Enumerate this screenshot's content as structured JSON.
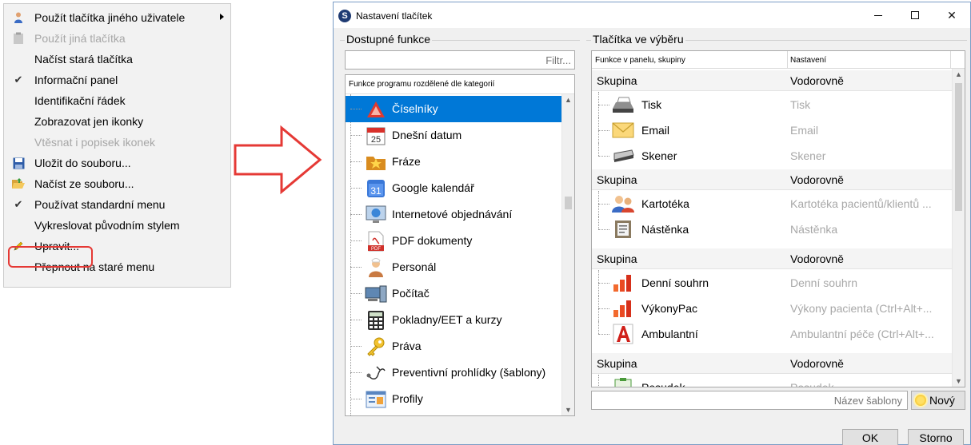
{
  "context_menu": {
    "items": [
      {
        "label": "Použít tlačítka jiného uživatele",
        "icon": "user-icon",
        "disabled": false,
        "checked": false,
        "submenu": true
      },
      {
        "label": "Použít jiná tlačítka",
        "icon": "clipboard-icon",
        "disabled": true,
        "checked": false,
        "submenu": false
      },
      {
        "label": "Načíst stará tlačítka",
        "icon": "",
        "disabled": false,
        "checked": false,
        "submenu": false
      },
      {
        "label": "Informační panel",
        "icon": "check-icon",
        "disabled": false,
        "checked": true,
        "submenu": false
      },
      {
        "label": "Identifikační řádek",
        "icon": "",
        "disabled": false,
        "checked": false,
        "submenu": false
      },
      {
        "label": "Zobrazovat jen ikonky",
        "icon": "",
        "disabled": false,
        "checked": false,
        "submenu": false
      },
      {
        "label": "Vtěsnat i popisek ikonek",
        "icon": "",
        "disabled": true,
        "checked": false,
        "submenu": false
      },
      {
        "label": "Uložit do souboru...",
        "icon": "floppy-icon",
        "disabled": false,
        "checked": false,
        "submenu": false
      },
      {
        "label": "Načíst ze souboru...",
        "icon": "folder-open-icon",
        "disabled": false,
        "checked": false,
        "submenu": false
      },
      {
        "label": "Používat standardní menu",
        "icon": "check-icon",
        "disabled": false,
        "checked": true,
        "submenu": false
      },
      {
        "label": "Vykreslovat původním stylem",
        "icon": "",
        "disabled": false,
        "checked": false,
        "submenu": false
      },
      {
        "label": "Upravit...",
        "icon": "pencil-icon",
        "disabled": false,
        "checked": false,
        "submenu": false
      },
      {
        "label": "Přepnout na staré menu",
        "icon": "",
        "disabled": false,
        "checked": false,
        "submenu": false
      }
    ]
  },
  "dialog": {
    "title": "Nastavení tlačítek",
    "app_icon_letter": "S",
    "left_group_title": "Dostupné funkce",
    "right_group_title": "Tlačítka ve výběru",
    "filter_placeholder": "Filtr...",
    "tree_header": "Funkce programu rozdělené dle kategorií",
    "tree_items": [
      {
        "label": "Číselníky",
        "icon": "ciselniky-icon",
        "selected": true
      },
      {
        "label": "Dnešní datum",
        "icon": "calendar-25-icon",
        "selected": false
      },
      {
        "label": "Fráze",
        "icon": "star-folder-icon",
        "selected": false
      },
      {
        "label": "Google kalendář",
        "icon": "google-calendar-icon",
        "selected": false
      },
      {
        "label": "Internetové objednávání",
        "icon": "monitor-globe-icon",
        "selected": false
      },
      {
        "label": "PDF dokumenty",
        "icon": "pdf-icon",
        "selected": false
      },
      {
        "label": "Personál",
        "icon": "nurse-icon",
        "selected": false
      },
      {
        "label": "Počítač",
        "icon": "computer-icon",
        "selected": false
      },
      {
        "label": "Pokladny/EET a kurzy",
        "icon": "calculator-icon",
        "selected": false
      },
      {
        "label": "Práva",
        "icon": "key-icon",
        "selected": false
      },
      {
        "label": "Preventivní prohlídky (šablony)",
        "icon": "stethoscope-icon",
        "selected": false
      },
      {
        "label": "Profily",
        "icon": "profile-window-icon",
        "selected": false
      }
    ],
    "table_header": {
      "col1": "Funkce v panelu, skupiny",
      "col2": "Nastavení"
    },
    "groups": [
      {
        "label": "Skupina",
        "setting": "Vodorovně",
        "rows": [
          {
            "label": "Tisk",
            "value": "Tisk",
            "icon": "printer-icon"
          },
          {
            "label": "Email",
            "value": "Email",
            "icon": "envelope-icon"
          },
          {
            "label": "Skener",
            "value": "Skener",
            "icon": "scanner-icon"
          }
        ]
      },
      {
        "label": "Skupina",
        "setting": "Vodorovně",
        "rows": [
          {
            "label": "Kartotéka",
            "value": "Kartotéka pacientů/klientů ...",
            "icon": "people-icon"
          },
          {
            "label": "Nástěnka",
            "value": "Nástěnka",
            "icon": "noticeboard-icon"
          }
        ]
      },
      {
        "label": "Skupina",
        "setting": "Vodorovně",
        "rows": [
          {
            "label": "Denní souhrn",
            "value": "Denní souhrn",
            "icon": "bar-chart-icon"
          },
          {
            "label": "VýkonyPac",
            "value": "Výkony pacienta (Ctrl+Alt+...",
            "icon": "bar-chart-icon"
          },
          {
            "label": "Ambulantní",
            "value": "Ambulantní péče (Ctrl+Alt+...",
            "icon": "letter-a-icon"
          }
        ]
      },
      {
        "label": "Skupina",
        "setting": "Vodorovně",
        "rows": [
          {
            "label": "Posudek",
            "value": "Posudek",
            "icon": "clipboard-green-icon"
          }
        ]
      }
    ],
    "template_placeholder": "Název šablony",
    "new_button": "Nový",
    "ok_button": "OK",
    "cancel_button": "Storno"
  }
}
